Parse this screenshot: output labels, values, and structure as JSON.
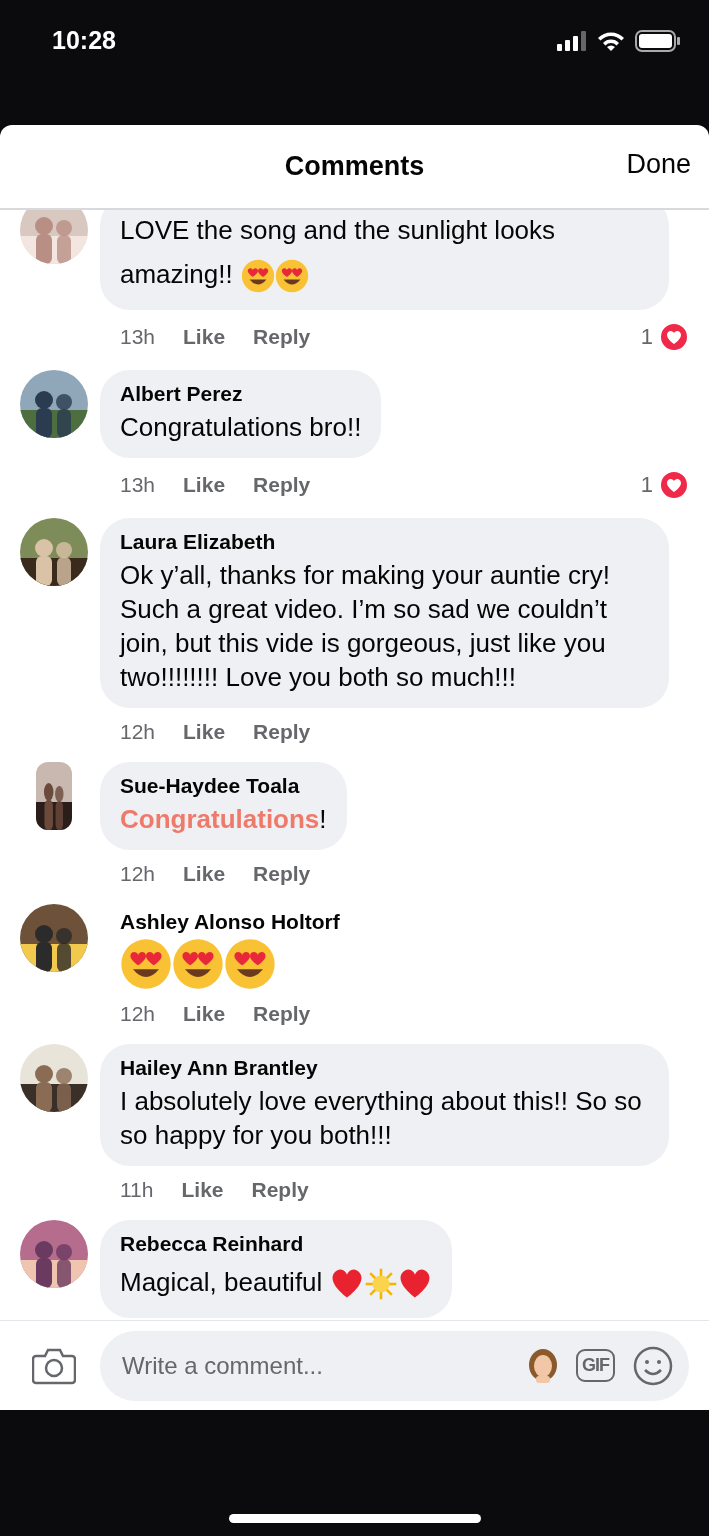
{
  "status_bar": {
    "time": "10:28"
  },
  "sheet": {
    "title": "Comments",
    "done": "Done"
  },
  "comments": [
    {
      "parts": [
        {
          "kind": "plain",
          "text": "LOVE the song and the sunlight looks"
        },
        {
          "kind": "plain",
          "text": "amazing!!"
        },
        {
          "kind": "heart_eyes"
        },
        {
          "kind": "heart_eyes"
        }
      ],
      "time": "13h",
      "like": "Like",
      "reply": "Reply",
      "reaction_count": "1"
    },
    {
      "author": "Albert Perez",
      "parts": [
        {
          "kind": "plain",
          "text": "Congratulations bro!!"
        }
      ],
      "time": "13h",
      "like": "Like",
      "reply": "Reply",
      "reaction_count": "1"
    },
    {
      "author": "Laura Elizabeth",
      "parts": [
        {
          "kind": "plain",
          "text": "Ok y’all, thanks for making your auntie cry! Such a great video. I’m so sad we couldn’t join, but this vide is gorgeous, just like you two!!!!!!!! Love you both so much!!!"
        }
      ],
      "time": "12h",
      "like": "Like",
      "reply": "Reply"
    },
    {
      "author": "Sue-Haydee Toala",
      "parts": [
        {
          "kind": "highlight",
          "text": "Congratulations"
        },
        {
          "kind": "plain",
          "text": "!"
        }
      ],
      "time": "12h",
      "like": "Like",
      "reply": "Reply"
    },
    {
      "author": "Ashley Alonso Holtorf",
      "bubble": false,
      "parts": [
        {
          "kind": "heart_eyes"
        },
        {
          "kind": "heart_eyes"
        },
        {
          "kind": "heart_eyes"
        }
      ],
      "time": "12h",
      "like": "Like",
      "reply": "Reply"
    },
    {
      "author": "Hailey Ann Brantley",
      "parts": [
        {
          "kind": "plain",
          "text": "I absolutely love everything about this!! So so so happy for you both!!!"
        }
      ],
      "time": "11h",
      "like": "Like",
      "reply": "Reply"
    },
    {
      "author": "Rebecca Reinhard",
      "parts": [
        {
          "kind": "plain",
          "text": "Magical, beautiful"
        },
        {
          "kind": "heart"
        },
        {
          "kind": "sun"
        },
        {
          "kind": "heart"
        }
      ]
    }
  ],
  "composer": {
    "placeholder": "Write a comment...",
    "gif_label": "GIF"
  }
}
